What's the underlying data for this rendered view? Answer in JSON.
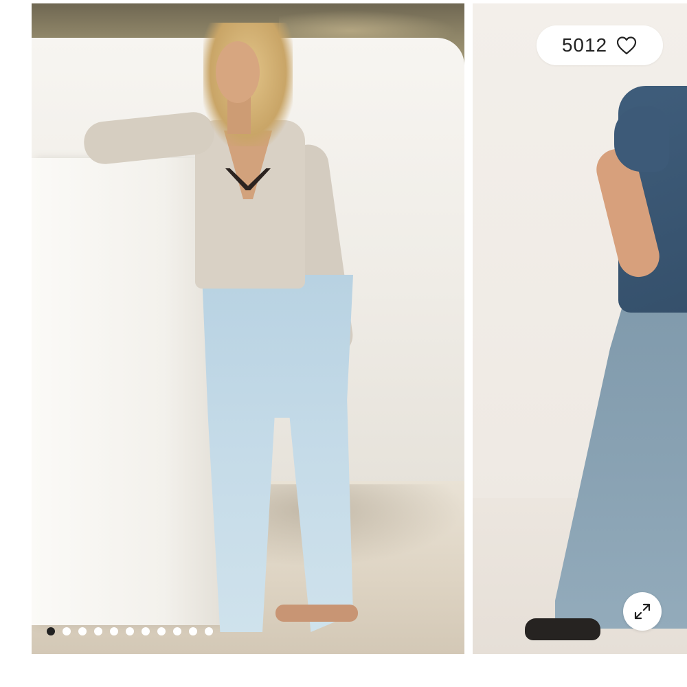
{
  "gallery": {
    "like_count": "5012",
    "like_icon": "heart-icon",
    "expand_icon": "expand-arrows-icon",
    "dots": {
      "count": 11,
      "active_index": 0
    },
    "colors": {
      "active_dot": "#222222",
      "inactive_dot": "#ffffff",
      "pill_bg": "#ffffff"
    }
  }
}
